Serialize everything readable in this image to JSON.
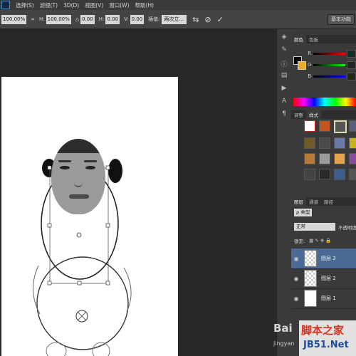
{
  "menu": {
    "items": [
      "选择(S)",
      "滤镜(T)",
      "3D(D)",
      "视图(V)",
      "窗口(W)",
      "帮助(H)"
    ]
  },
  "options": {
    "w": "100.00%",
    "link_icon": "link-icon",
    "h": "100.00%",
    "angle_lbl": "△",
    "angle": "0.00",
    "h_lbl": "H:",
    "hskew": "0.00",
    "v_lbl": "V:",
    "vskew": "0.00",
    "interp_lbl": "插值:",
    "interp": "两次立...",
    "right_btn": "基本功能"
  },
  "panels": {
    "color_tabs": [
      "颜色",
      "色板"
    ],
    "slider_labels": [
      "R",
      "G",
      "B"
    ],
    "styles_tabs": [
      "调整",
      "样式"
    ],
    "layers_tabs": [
      "图层",
      "通道",
      "路径"
    ],
    "kind": "ρ 类型",
    "blend_mode": "正常",
    "opacity_lbl": "不透明度:",
    "lock_lbl": "锁定:",
    "layers": [
      {
        "name": "图层 3",
        "selected": true
      },
      {
        "name": "图层 2",
        "selected": false
      },
      {
        "name": "图层 1",
        "selected": false
      }
    ]
  },
  "watermarks": {
    "baidu": "Bai",
    "jingyan": "jingyan",
    "jb51_cn": "脚本之家",
    "jb51_url": "JB51.Net"
  },
  "colors": {
    "selected_layer": "#4a6a96",
    "background_swatch": "#e8b020"
  }
}
